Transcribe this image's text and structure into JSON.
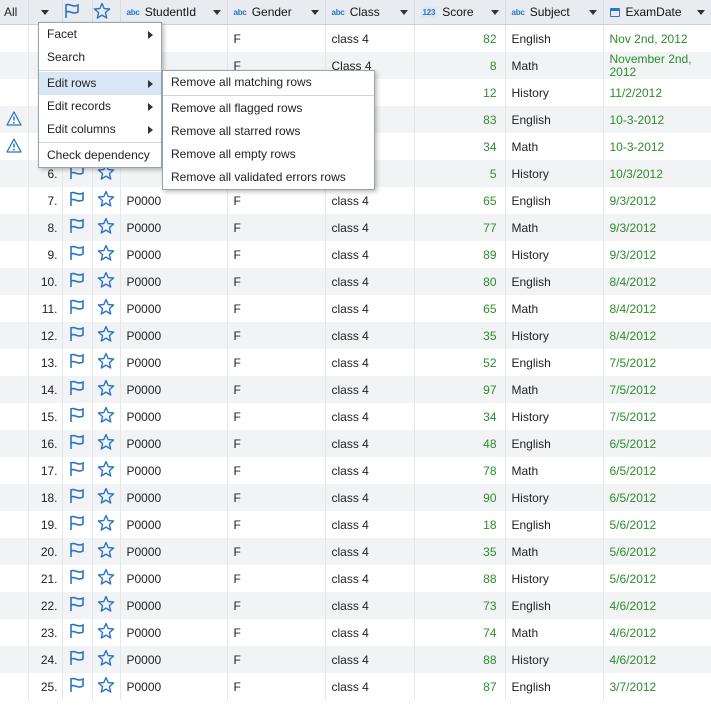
{
  "header": {
    "all_label": "All",
    "columns": [
      {
        "name": "StudentId",
        "type": "abc"
      },
      {
        "name": "Gender",
        "type": "abc"
      },
      {
        "name": "Class",
        "type": "abc"
      },
      {
        "name": "Score",
        "type": "123"
      },
      {
        "name": "Subject",
        "type": "abc"
      },
      {
        "name": "ExamDate",
        "type": "date"
      }
    ]
  },
  "rows": [
    {
      "num": "",
      "warn": false,
      "student": "",
      "gender": "F",
      "class": "class 4",
      "score": "82",
      "subject": "English",
      "date": "Nov 2nd, 2012"
    },
    {
      "num": "",
      "warn": false,
      "student": "",
      "gender": "F",
      "class": "Class 4",
      "score": "8",
      "subject": "Math",
      "date": "November 2nd, 2012"
    },
    {
      "num": "",
      "warn": false,
      "student": "",
      "gender": "",
      "class": "",
      "score": "12",
      "subject": "History",
      "date": "11/2/2012"
    },
    {
      "num": "",
      "warn": true,
      "student": "",
      "gender": "",
      "class": "",
      "score": "83",
      "subject": "English",
      "date": "10-3-2012"
    },
    {
      "num": "",
      "warn": true,
      "student": "",
      "gender": "",
      "class": "",
      "score": "34",
      "subject": "Math",
      "date": "10-3-2012"
    },
    {
      "num": "6.",
      "warn": false,
      "student": "",
      "gender": "",
      "class": "",
      "score": "5",
      "subject": "History",
      "date": "10/3/2012"
    },
    {
      "num": "7.",
      "warn": false,
      "student": "P0000",
      "gender": "F",
      "class": "class 4",
      "score": "65",
      "subject": "English",
      "date": "9/3/2012"
    },
    {
      "num": "8.",
      "warn": false,
      "student": "P0000",
      "gender": "F",
      "class": "class 4",
      "score": "77",
      "subject": "Math",
      "date": "9/3/2012"
    },
    {
      "num": "9.",
      "warn": false,
      "student": "P0000",
      "gender": "F",
      "class": "class 4",
      "score": "89",
      "subject": "History",
      "date": "9/3/2012"
    },
    {
      "num": "10.",
      "warn": false,
      "student": "P0000",
      "gender": "F",
      "class": "class 4",
      "score": "80",
      "subject": "English",
      "date": "8/4/2012"
    },
    {
      "num": "11.",
      "warn": false,
      "student": "P0000",
      "gender": "F",
      "class": "class 4",
      "score": "65",
      "subject": "Math",
      "date": "8/4/2012"
    },
    {
      "num": "12.",
      "warn": false,
      "student": "P0000",
      "gender": "F",
      "class": "class 4",
      "score": "35",
      "subject": "History",
      "date": "8/4/2012"
    },
    {
      "num": "13.",
      "warn": false,
      "student": "P0000",
      "gender": "F",
      "class": "class 4",
      "score": "52",
      "subject": "English",
      "date": "7/5/2012"
    },
    {
      "num": "14.",
      "warn": false,
      "student": "P0000",
      "gender": "F",
      "class": "class 4",
      "score": "97",
      "subject": "Math",
      "date": "7/5/2012"
    },
    {
      "num": "15.",
      "warn": false,
      "student": "P0000",
      "gender": "F",
      "class": "class 4",
      "score": "34",
      "subject": "History",
      "date": "7/5/2012"
    },
    {
      "num": "16.",
      "warn": false,
      "student": "P0000",
      "gender": "F",
      "class": "class 4",
      "score": "48",
      "subject": "English",
      "date": "6/5/2012"
    },
    {
      "num": "17.",
      "warn": false,
      "student": "P0000",
      "gender": "F",
      "class": "class 4",
      "score": "78",
      "subject": "Math",
      "date": "6/5/2012"
    },
    {
      "num": "18.",
      "warn": false,
      "student": "P0000",
      "gender": "F",
      "class": "class 4",
      "score": "90",
      "subject": "History",
      "date": "6/5/2012"
    },
    {
      "num": "19.",
      "warn": false,
      "student": "P0000",
      "gender": "F",
      "class": "class 4",
      "score": "18",
      "subject": "English",
      "date": "5/6/2012"
    },
    {
      "num": "20.",
      "warn": false,
      "student": "P0000",
      "gender": "F",
      "class": "class 4",
      "score": "35",
      "subject": "Math",
      "date": "5/6/2012"
    },
    {
      "num": "21.",
      "warn": false,
      "student": "P0000",
      "gender": "F",
      "class": "class 4",
      "score": "88",
      "subject": "History",
      "date": "5/6/2012"
    },
    {
      "num": "22.",
      "warn": false,
      "student": "P0000",
      "gender": "F",
      "class": "class 4",
      "score": "73",
      "subject": "English",
      "date": "4/6/2012"
    },
    {
      "num": "23.",
      "warn": false,
      "student": "P0000",
      "gender": "F",
      "class": "class 4",
      "score": "74",
      "subject": "Math",
      "date": "4/6/2012"
    },
    {
      "num": "24.",
      "warn": false,
      "student": "P0000",
      "gender": "F",
      "class": "class 4",
      "score": "88",
      "subject": "History",
      "date": "4/6/2012"
    },
    {
      "num": "25.",
      "warn": false,
      "student": "P0000",
      "gender": "F",
      "class": "class 4",
      "score": "87",
      "subject": "English",
      "date": "3/7/2012"
    }
  ],
  "menu": {
    "items": [
      "Facet",
      "Search",
      "Edit rows",
      "Edit records",
      "Edit columns",
      "Check dependency"
    ],
    "active": "Edit rows",
    "submenu": [
      "Remove all matching rows",
      "Remove all flagged rows",
      "Remove all starred rows",
      "Remove all empty rows",
      "Remove all validated errors rows"
    ]
  },
  "colors": {
    "accent": "#2b74c7",
    "value_green": "#2d8c2d",
    "warning": "#2b74c7"
  },
  "icons": {
    "row_flag": "flag-icon",
    "row_star": "star-icon",
    "warning": "warning-icon"
  }
}
